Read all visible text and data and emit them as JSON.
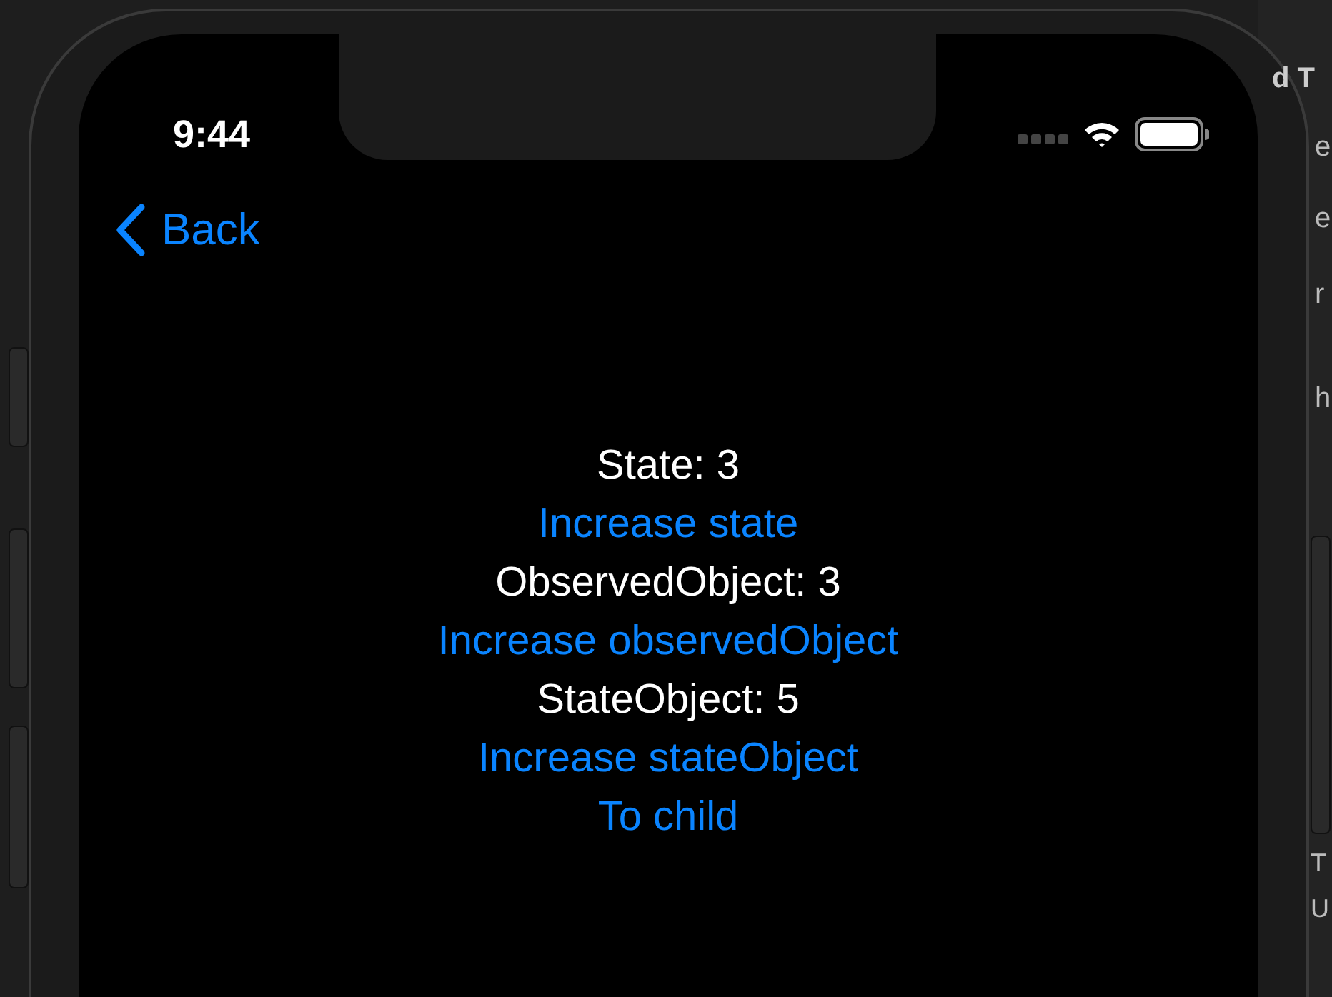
{
  "status_bar": {
    "time": "9:44"
  },
  "nav": {
    "back_label": "Back"
  },
  "content": [
    {
      "kind": "text",
      "text": "State: 3"
    },
    {
      "kind": "link",
      "text": "Increase state"
    },
    {
      "kind": "text",
      "text": "ObservedObject: 3"
    },
    {
      "kind": "link",
      "text": "Increase observedObject"
    },
    {
      "kind": "text",
      "text": "StateObject: 5"
    },
    {
      "kind": "link",
      "text": "Increase stateObject"
    },
    {
      "kind": "link",
      "text": "To child"
    }
  ],
  "background_panel_fragments": [
    "d T",
    "e",
    "e",
    "r",
    "h",
    "T",
    "U"
  ]
}
